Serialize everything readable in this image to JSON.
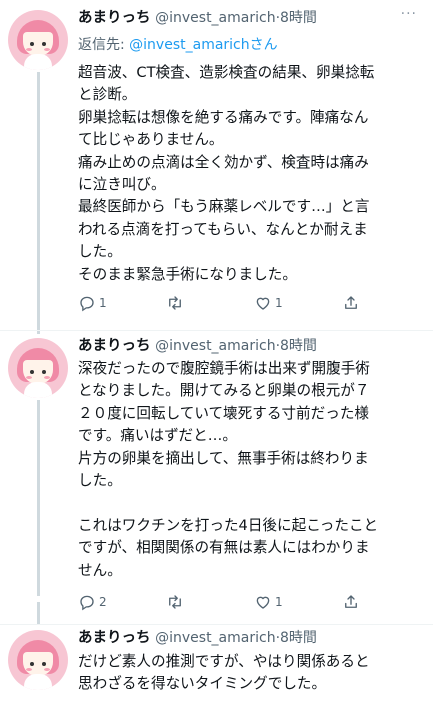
{
  "tweets": [
    {
      "name": "あまりっち",
      "handle": "@invest_amarich",
      "time": "·8時間",
      "more": "···",
      "reply_prefix": "返信先: ",
      "reply_mention": "@invest_amarichさん",
      "lines": [
        "超音波、CT検査、造影検査の結果、卵巣捻転",
        "と診断。",
        "卵巣捻転は想像を絶する痛みです。陣痛なん",
        "て比じゃありません。",
        "痛み止めの点滴は全く効かず、検査時は痛み",
        "に泣き叫び。",
        "最終医師から「もう麻薬レベルです…」と言",
        "われる点滴を打ってもらい、なんとか耐えま",
        "した。",
        "そのまま緊急手術になりました。"
      ],
      "reply_count": "1",
      "retweet_count": "",
      "like_count": "1"
    },
    {
      "name": "あまりっち",
      "handle": "@invest_amarich",
      "time": "·8時間",
      "more": "···",
      "lines": [
        "深夜だったので腹腔鏡手術は出来ず開腹手術",
        "となりました。開けてみると卵巣の根元が７",
        "２０度に回転していて壊死する寸前だった様",
        "です。痛いはずだと…。",
        "片方の卵巣を摘出して、無事手術は終わりま",
        "した。",
        "",
        "これはワクチンを打った4日後に起こったこと",
        "ですが、相関関係の有無は素人にはわかりま",
        "せん。"
      ],
      "reply_count": "2",
      "retweet_count": "",
      "like_count": "1"
    },
    {
      "name": "あまりっち",
      "handle": "@invest_amarich",
      "time": "·8時間",
      "more": "···",
      "lines": [
        "だけど素人の推測ですが、やはり関係あると",
        "思わざるを得ないタイミングでした。"
      ]
    }
  ],
  "icons": {
    "reply": "reply-icon",
    "retweet": "retweet-icon",
    "like": "heart-icon",
    "share": "share-icon"
  }
}
